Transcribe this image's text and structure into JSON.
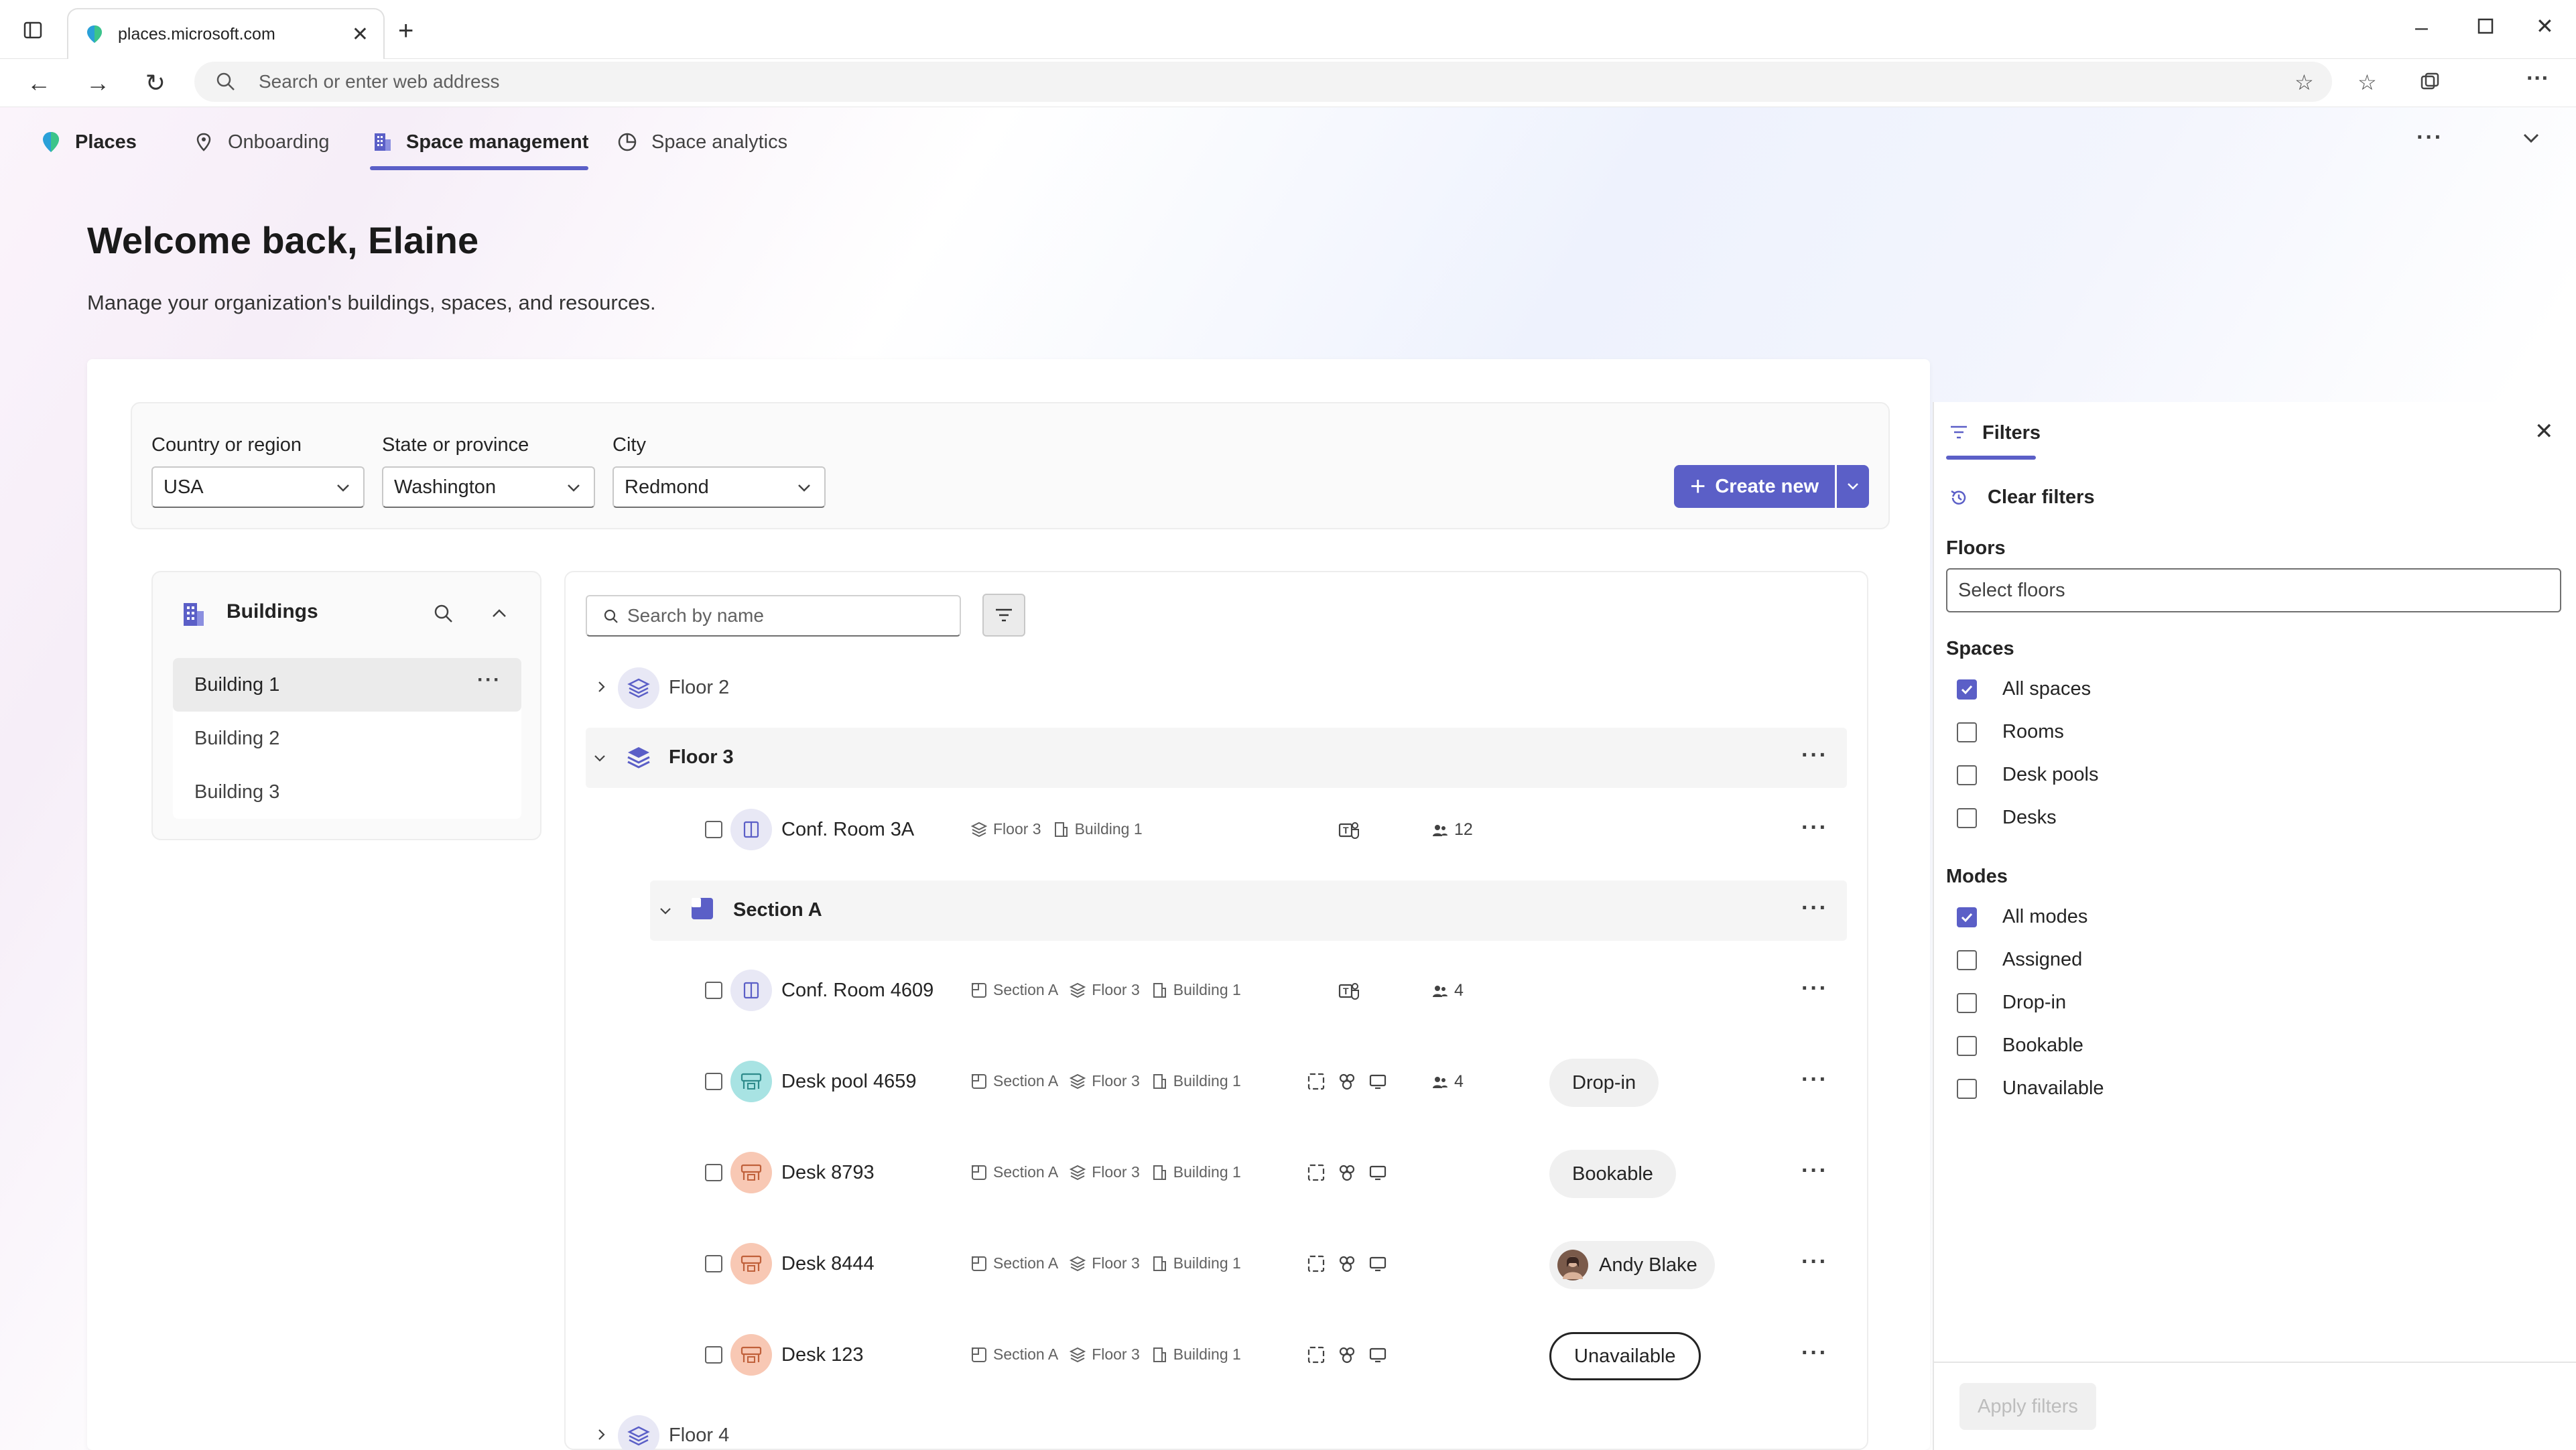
{
  "browser": {
    "tab_title": "places.microsoft.com",
    "address_placeholder": "Search or enter web address"
  },
  "app": {
    "brand": "Places",
    "nav": [
      {
        "label": "Onboarding",
        "icon": "onboarding-icon"
      },
      {
        "label": "Space management",
        "icon": "building-icon",
        "active": true
      },
      {
        "label": "Space analytics",
        "icon": "analytics-icon"
      }
    ],
    "accent_color": "#5b5fc7"
  },
  "header": {
    "title": "Welcome back, Elaine",
    "subtitle": "Manage your organization's buildings, spaces, and resources."
  },
  "location": {
    "country_label": "Country or region",
    "country_value": "USA",
    "state_label": "State or province",
    "state_value": "Washington",
    "city_label": "City",
    "city_value": "Redmond",
    "create_label": "Create new"
  },
  "buildings": {
    "title": "Buildings",
    "items": [
      "Building 1",
      "Building 2",
      "Building 3"
    ]
  },
  "list": {
    "search_placeholder": "Search by name",
    "floor2": "Floor 2",
    "floor3": "Floor 3",
    "floor4": "Floor 4",
    "section_a": "Section A",
    "rows": [
      {
        "name": "Conf. Room 3A",
        "section": "",
        "floor": "Floor 3",
        "building": "Building 1",
        "capacity": "12",
        "status": ""
      },
      {
        "name": "Conf. Room 4609",
        "section": "Section A",
        "floor": "Floor 3",
        "building": "Building 1",
        "capacity": "4",
        "status": ""
      },
      {
        "name": "Desk pool 4659",
        "section": "Section A",
        "floor": "Floor 3",
        "building": "Building 1",
        "capacity": "4",
        "status": "Drop-in"
      },
      {
        "name": "Desk 8793",
        "section": "Section A",
        "floor": "Floor 3",
        "building": "Building 1",
        "capacity": "",
        "status": "Bookable"
      },
      {
        "name": "Desk 8444",
        "section": "Section A",
        "floor": "Floor 3",
        "building": "Building 1",
        "capacity": "",
        "status": "Andy Blake"
      },
      {
        "name": "Desk 123",
        "section": "Section A",
        "floor": "Floor 3",
        "building": "Building 1",
        "capacity": "",
        "status": "Unavailable"
      }
    ]
  },
  "filters": {
    "title": "Filters",
    "clear": "Clear filters",
    "floors_label": "Floors",
    "floors_placeholder": "Select floors",
    "spaces_label": "Spaces",
    "spaces": [
      {
        "label": "All spaces",
        "checked": true
      },
      {
        "label": "Rooms",
        "checked": false
      },
      {
        "label": "Desk pools",
        "checked": false
      },
      {
        "label": "Desks",
        "checked": false
      }
    ],
    "modes_label": "Modes",
    "modes": [
      {
        "label": "All modes",
        "checked": true
      },
      {
        "label": "Assigned",
        "checked": false
      },
      {
        "label": "Drop-in",
        "checked": false
      },
      {
        "label": "Bookable",
        "checked": false
      },
      {
        "label": "Unavailable",
        "checked": false
      }
    ],
    "apply": "Apply filters"
  }
}
